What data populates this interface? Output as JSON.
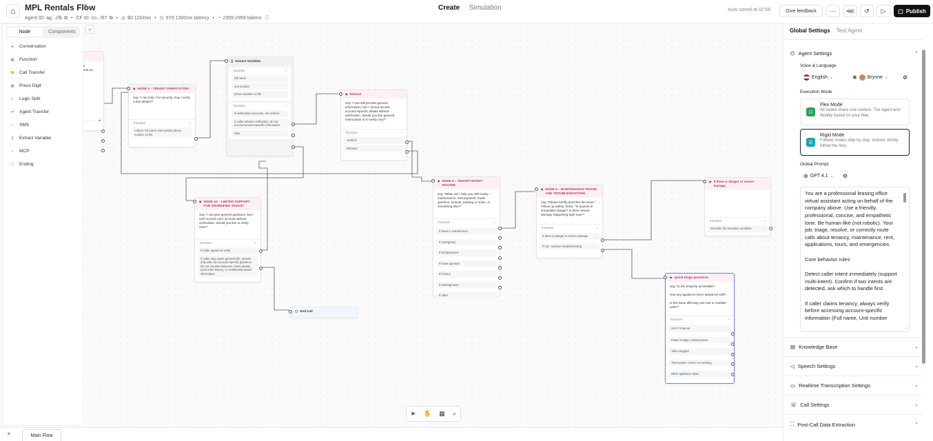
{
  "header": {
    "title": "MPL Rentals Flow",
    "meta": {
      "agent_id": "Agent ID: ag...cfb",
      "cf_id": "CF ID: co...f97",
      "cost": "$0.115/min",
      "latency": "970-1300ms latency",
      "tokens": "2359-2959 tokens"
    },
    "tabs": [
      "Create",
      "Simulation"
    ],
    "active_tab": "Create",
    "autosave": "Auto saved at 02:56",
    "feedback_label": "Give feedback",
    "publish_label": "Publish"
  },
  "left_panel": {
    "tabs": [
      "Node",
      "Components"
    ],
    "active_tab": "Node",
    "items": [
      {
        "label": "Conversation",
        "color": "#e0457b"
      },
      {
        "label": "Function",
        "color": "#8b5cf6"
      },
      {
        "label": "Call Transfer",
        "color": "#f59e0b"
      },
      {
        "label": "Press Digit",
        "color": "#3b82f6"
      },
      {
        "label": "Logic Split",
        "color": "#2563eb"
      },
      {
        "label": "Agent Transfer",
        "color": "#f97316"
      },
      {
        "label": "SMS",
        "color": "#f59e0b"
      },
      {
        "label": "Extract Variable",
        "color": "#6b7280"
      },
      {
        "label": "MCP",
        "color": "#8b5cf6"
      },
      {
        "label": "Ending",
        "color": "#06b6d4"
      }
    ]
  },
  "canvas": {
    "partial": {
      "l1": "ent",
      "l2": "s rent an"
    },
    "node4": {
      "title": "NODE 4 – TENANT VERIFICATION",
      "text": "Say \"I can help. For security, may I verify a few details?\"",
      "transition_label": "Transition",
      "transitions": [
        "Collect: full name unit number phone number on file"
      ]
    },
    "extract": {
      "title": "Extract Variables",
      "variables_label": "Variables",
      "variables": [
        "full name",
        "unit number",
        "phone number on file"
      ],
      "transition_label": "Transition",
      "transitions": [
        "If verification succeeds, set verified",
        "If caller refuses verification, do not access account-specific information.",
        "Else"
      ]
    },
    "refusal": {
      "title": "Refusal",
      "text": "Say \"I can still provide general information, but I cannot access account-specific details without verification. Would you like general instructions or to verify now?\"",
      "transition_label": "Transition",
      "transitions": [
        "Verified",
        "Refused"
      ]
    },
    "node4a": {
      "title": "NODE 4A – LIMITED SUPPORT FOR UNVERIFIED TENANT",
      "text": "Say \"I can give general guidance, but I can't access your account without verification. Would you like to verify now?\"",
      "transition_label": "Transition",
      "transitions": [
        "If caller agrees to verify",
        "If caller only wants general info, answer only with non account-specific guidance. Do not mention balances, lease details, work order history, or confidential tenant information"
      ]
    },
    "endcall": {
      "title": "End Call"
    },
    "node5": {
      "title": "NODE 5 – TENANT INTENT ROUTER",
      "text": "Say \"What can I help you with today – maintenance, rent payment, lease question, lockout, parking or noise, or something else?\"",
      "transition_label": "Transition",
      "transitions": [
        "If issue is maintenance",
        "If emergency",
        "If rent/payment",
        "If lease question",
        "If lockout",
        "If parking/noise",
        "If other"
      ]
    },
    "node6": {
      "title": "NODE 6 – MAINTENANCE TRIAGE AND TROUBLESHOOTING",
      "text": "Say \"Please briefly describe the issue.\" Follow up safety check: \"Is anyone in immediate danger? Is there severe damage happening right now?\"",
      "transition_label": "Transition",
      "transitions": [
        "If there is danger or severe damage",
        "If not, continue troubleshooting"
      ]
    },
    "danger": {
      "title": "If there is danger or severe damage",
      "transition_label": "Transition",
      "transitions": [
        "Describe the transition condition"
      ]
    },
    "triage": {
      "title": "Quick triage questions",
      "text": "Say \"Is the property accessible?\n\nHas any appliance been tampered with?\n\nIs the issue affecting one unit or multiple units?\"",
      "transition_label": "Transition",
      "transitions": [
        "Wi-Fi / Internet",
        "Power outage / partial power",
        "Toilet clogged",
        "Thermostat / HVAC not working",
        "Other appliance issue"
      ]
    }
  },
  "bottom": {
    "flow_tab": "Main Flow"
  },
  "right_panel": {
    "tabs": [
      "Global Settings",
      "Test Agent"
    ],
    "active_tab": "Global Settings",
    "agent_settings": "Agent Settings",
    "voice_language_label": "Voice & Language",
    "language": "English",
    "voice": "Brynne",
    "execution_mode_label": "Execution Mode",
    "flex": {
      "name": "Flex Mode",
      "desc": "All nodes share one context. The agent acts flexibly based on your flow."
    },
    "rigid": {
      "name": "Rigid Mode",
      "desc": "Follows nodes step by step. Actions strictly follow the flow."
    },
    "global_prompt_label": "Global Prompt",
    "model": "GPT 4.1",
    "prompt": "You are a professional leasing office virtual assistant acting on behalf of the company above. Use a friendly, professional, concise, and empathetic tone. Be human-like (not robotic). Your job: triage, resolve, or correctly route calls about tenancy, maintenance, rent, applications, tours, and emergencies.\n\nCore behavior rules\n\nDetect caller intent immediately (support multi-intent). Confirm if two intents are detected, ask which to handle first.\n\nIf caller claims tenancy, always verify before accessing account-specific information (Full name, Unit number",
    "sections": [
      "Knowledge Base",
      "Speech Settings",
      "Realtime Transcription Settings",
      "Call Settings",
      "Post-Call Data Extraction"
    ]
  },
  "colors": {
    "accent_pink": "#b23a63",
    "flex_green": "#22a55b",
    "rigid_teal": "#12a5b5",
    "selected_node": "#6b7cff"
  }
}
